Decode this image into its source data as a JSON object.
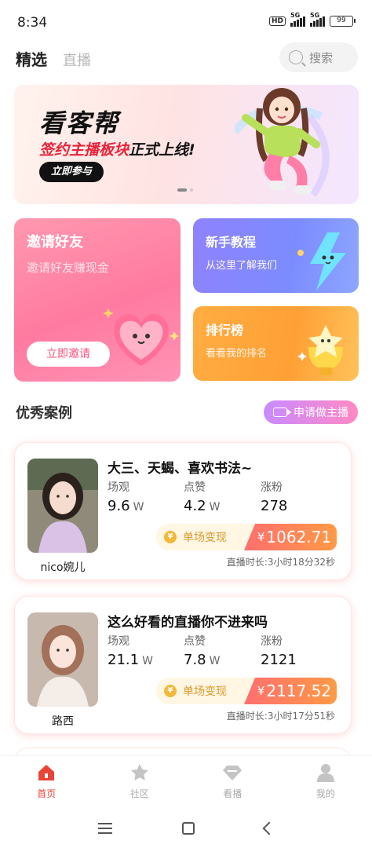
{
  "status_bar": {
    "time": "8:34",
    "hd": "HD",
    "network1": "5G",
    "network2": "5G",
    "battery": "99"
  },
  "header": {
    "tabs": [
      {
        "label": "精选",
        "active": true
      },
      {
        "label": "直播",
        "active": false
      }
    ],
    "search_label": "搜索"
  },
  "banner": {
    "title": "看客帮",
    "subtitle_red": "签约主播板块",
    "subtitle_black": "正式上线!",
    "button_label": "立即参与"
  },
  "features": {
    "invite": {
      "title": "邀请好友",
      "subtitle": "邀请好友赚现金",
      "button_label": "立即邀请"
    },
    "tutorial": {
      "title": "新手教程",
      "subtitle": "从这里了解我们"
    },
    "ranking": {
      "title": "排行榜",
      "subtitle": "看看我的排名"
    }
  },
  "section": {
    "title": "优秀案例",
    "apply_label": "申请做主播"
  },
  "stat_labels": {
    "views": "场观",
    "likes": "点赞",
    "fans": "涨粉",
    "unit": "W",
    "earn_label": "单场变现",
    "currency": "¥",
    "coin": "¥"
  },
  "cases": [
    {
      "name": "nico婉儿",
      "title": "大三、天蝎、喜欢书法~",
      "views": "9.6",
      "likes": "4.2",
      "fans": "278",
      "earnings": "1062.71",
      "duration": "直播时长:3小时18分32秒"
    },
    {
      "name": "路西",
      "title": "这么好看的直播你不进来吗",
      "views": "21.1",
      "likes": "7.8",
      "fans": "2121",
      "earnings": "2117.52",
      "duration": "直播时长:3小时17分51秒"
    }
  ],
  "bottom_nav": [
    {
      "label": "首页",
      "active": true,
      "icon": "home-icon"
    },
    {
      "label": "社区",
      "active": false,
      "icon": "star-icon"
    },
    {
      "label": "看播",
      "active": false,
      "icon": "diamond-icon"
    },
    {
      "label": "我的",
      "active": false,
      "icon": "user-icon"
    }
  ],
  "colors": {
    "accent": "#e84438",
    "pink": "#ff7aa0",
    "purple": "#8f82ff",
    "orange": "#ffa035"
  }
}
